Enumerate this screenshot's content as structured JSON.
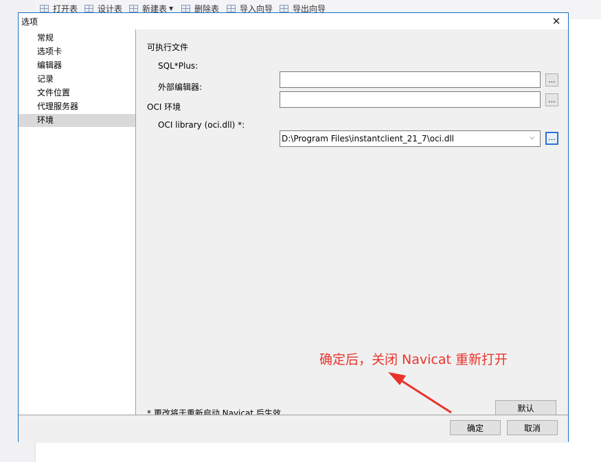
{
  "background_toolbar": {
    "items": [
      "打开表",
      "设计表",
      "新建表",
      "删除表",
      "导入向导",
      "导出向导"
    ]
  },
  "dialog": {
    "title": "选项",
    "close_glyph": "✕"
  },
  "sidebar": {
    "items": [
      {
        "label": "常规"
      },
      {
        "label": "选项卡"
      },
      {
        "label": "编辑器"
      },
      {
        "label": "记录"
      },
      {
        "label": "文件位置"
      },
      {
        "label": "代理服务器"
      },
      {
        "label": "环境",
        "selected": true
      }
    ]
  },
  "content": {
    "exec_section_title": "可执行文件",
    "sqlplus_label": "SQL*Plus:",
    "sqlplus_value": "",
    "editor_label": "外部编辑器:",
    "editor_value": "",
    "oci_section_title": "OCI 环境",
    "oci_label": "OCI library (oci.dll) *:",
    "oci_value": "D:\\Program Files\\instantclient_21_7\\oci.dll",
    "browse_label": "...",
    "note": "* 更改将于重新启动 Navicat 后生效",
    "default_button": "默认"
  },
  "footer": {
    "ok_button": "确定",
    "cancel_button": "取消"
  },
  "annotation": {
    "text": "确定后，关闭 Navicat 重新打开",
    "color": "#e8342b"
  },
  "colors": {
    "dialog_border": "#1a6fc8",
    "selected_item": "#d9d9d9",
    "focus_border": "#2a72d4"
  }
}
